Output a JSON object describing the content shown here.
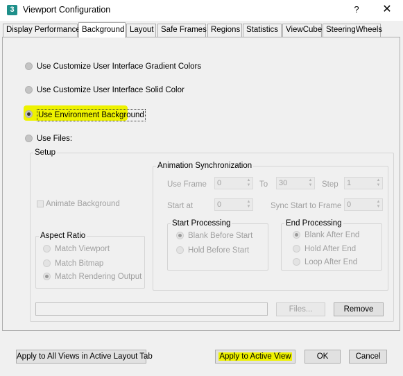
{
  "window": {
    "app_icon_glyph": "3",
    "title": "Viewport Configuration",
    "help_label": "?",
    "close_label": "✕"
  },
  "tabs": [
    {
      "label": "Display Performance",
      "active": false
    },
    {
      "label": "Background",
      "active": true
    },
    {
      "label": "Layout",
      "active": false
    },
    {
      "label": "Safe Frames",
      "active": false
    },
    {
      "label": "Regions",
      "active": false
    },
    {
      "label": "Statistics",
      "active": false
    },
    {
      "label": "ViewCube",
      "active": false
    },
    {
      "label": "SteeringWheels",
      "active": false
    }
  ],
  "background_options": {
    "gradient": "Use Customize User Interface Gradient Colors",
    "solid": "Use Customize User Interface Solid Color",
    "environment": "Use Environment Background",
    "files": "Use Files:",
    "selected": "environment"
  },
  "setup": {
    "title": "Setup",
    "animate_background": "Animate Background",
    "aspect_ratio": {
      "title": "Aspect Ratio",
      "options": [
        "Match Viewport",
        "Match Bitmap",
        "Match Rendering Output"
      ],
      "selected_index": 2
    },
    "animation_sync": {
      "title": "Animation Synchronization",
      "use_frame_label": "Use Frame",
      "use_frame_value": "0",
      "to_label": "To",
      "to_value": "30",
      "step_label": "Step",
      "step_value": "1",
      "start_at_label": "Start at",
      "start_at_value": "0",
      "sync_start_label": "Sync Start to Frame",
      "sync_start_value": "0",
      "start_processing": {
        "title": "Start Processing",
        "options": [
          "Blank Before Start",
          "Hold Before Start"
        ],
        "selected_index": 0
      },
      "end_processing": {
        "title": "End Processing",
        "options": [
          "Blank After End",
          "Hold After End",
          "Loop After End"
        ],
        "selected_index": 0
      }
    },
    "files_button": "Files...",
    "remove_button": "Remove",
    "path_value": ""
  },
  "footer": {
    "apply_all": "Apply to All Views in Active Layout Tab",
    "apply_active": "Apply to Active View",
    "ok": "OK",
    "cancel": "Cancel"
  },
  "colors": {
    "highlight": "#eef200",
    "app_icon": "#1e8f8a"
  }
}
